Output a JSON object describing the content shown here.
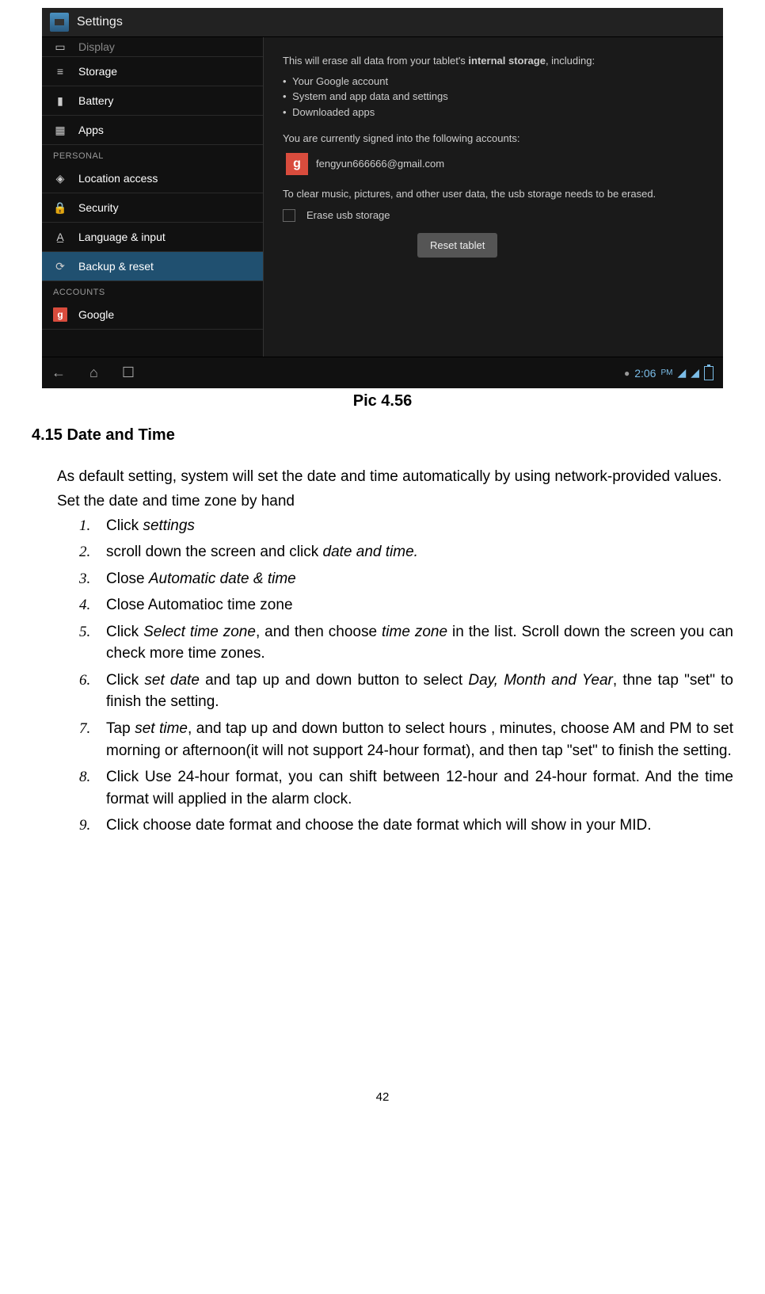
{
  "screenshot": {
    "header_title": "Settings",
    "sidebar": {
      "items": [
        {
          "label": "Display",
          "icon": "display-icon",
          "cut": true
        },
        {
          "label": "Storage",
          "icon": "storage-icon"
        },
        {
          "label": "Battery",
          "icon": "battery-icon"
        },
        {
          "label": "Apps",
          "icon": "apps-icon"
        }
      ],
      "personal_header": "PERSONAL",
      "personal_items": [
        {
          "label": "Location access",
          "icon": "location-icon"
        },
        {
          "label": "Security",
          "icon": "lock-icon"
        },
        {
          "label": "Language & input",
          "icon": "language-icon"
        },
        {
          "label": "Backup & reset",
          "icon": "backup-icon",
          "selected": true
        }
      ],
      "accounts_header": "ACCOUNTS",
      "account_items": [
        {
          "label": "Google",
          "icon": "google-icon"
        }
      ]
    },
    "content": {
      "intro_prefix": "This will erase all data from your tablet's ",
      "intro_bold": "internal storage",
      "intro_suffix": ", including:",
      "bullets": [
        "Your Google account",
        "System and app data and settings",
        "Downloaded apps"
      ],
      "accounts_line": "You are currently signed into the following accounts:",
      "account_email": "fengyun666666@gmail.com",
      "clear_text": "To clear music, pictures, and other user data, the usb storage needs to be erased.",
      "checkbox_label": "Erase usb storage",
      "button_label": "Reset tablet"
    },
    "navbar": {
      "time": "2:06",
      "ampm": "PM"
    }
  },
  "caption": "Pic 4.56",
  "section_title": "4.15 Date and Time",
  "intro_text": "As default setting, system will set the date and time automatically by using network-provided values.",
  "list_intro": "Set the date and time zone by hand",
  "steps": [
    {
      "num": "1.",
      "parts": [
        {
          "t": "Click "
        },
        {
          "t": "settings",
          "i": true
        }
      ]
    },
    {
      "num": "2.",
      "parts": [
        {
          "t": "scroll down the screen and click "
        },
        {
          "t": "date and time.",
          "i": true
        }
      ]
    },
    {
      "num": "3.",
      "parts": [
        {
          "t": "Close "
        },
        {
          "t": "Automatic date & time",
          "i": true
        }
      ]
    },
    {
      "num": "4.",
      "parts": [
        {
          "t": "Close Automatioc time zone"
        }
      ]
    },
    {
      "num": "5.",
      "parts": [
        {
          "t": "Click "
        },
        {
          "t": "Select time zone",
          "i": true
        },
        {
          "t": ", and then choose "
        },
        {
          "t": "time zone",
          "i": true
        },
        {
          "t": " in the list. Scroll down the screen you can check more time zones."
        }
      ]
    },
    {
      "num": "6.",
      "parts": [
        {
          "t": "Click "
        },
        {
          "t": "set date",
          "i": true
        },
        {
          "t": " and tap up and down button to select "
        },
        {
          "t": "Day, Month and Year",
          "i": true
        },
        {
          "t": ", thne tap \"set\" to finish the setting."
        }
      ]
    },
    {
      "num": "7.",
      "parts": [
        {
          "t": "Tap "
        },
        {
          "t": "set time",
          "i": true
        },
        {
          "t": ", and tap up and down button to select hours , minutes, choose AM and PM to set morning or afternoon(it will not support 24-hour format), and then tap \"set\" to finish the setting."
        }
      ]
    },
    {
      "num": "8.",
      "parts": [
        {
          "t": "Click Use 24-hour format, you can shift between 12-hour and 24-hour format. And the time format will applied in the alarm clock."
        }
      ]
    },
    {
      "num": "9.",
      "parts": [
        {
          "t": "Click choose date format and choose the date format which will show in your MID."
        }
      ]
    }
  ],
  "page_number": "42"
}
